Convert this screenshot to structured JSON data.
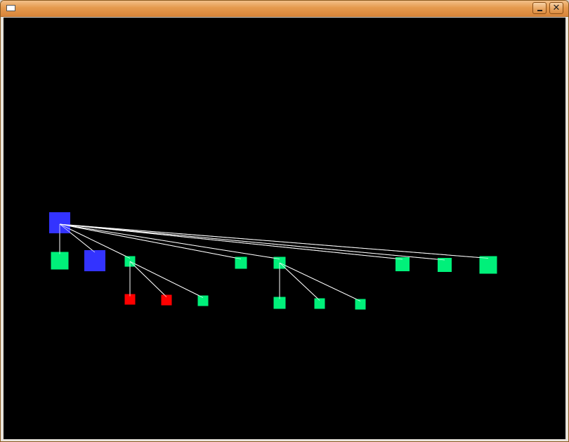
{
  "window": {
    "title": "",
    "icon": "window-icon",
    "buttons": {
      "minimize": "minimize-icon",
      "close": "close-icon"
    }
  },
  "canvas": {
    "background": "#000000",
    "edge_color": "#ffffff",
    "colors": {
      "blue": "#3333ff",
      "green": "#00f07a",
      "red": "#ff0000"
    }
  },
  "tree": {
    "nodes": [
      {
        "id": "root",
        "color": "blue"
      },
      {
        "id": "c1",
        "color": "green"
      },
      {
        "id": "c2",
        "color": "blue"
      },
      {
        "id": "c3",
        "color": "green"
      },
      {
        "id": "c4",
        "color": "green"
      },
      {
        "id": "c5",
        "color": "green"
      },
      {
        "id": "c6",
        "color": "green"
      },
      {
        "id": "c7",
        "color": "green"
      },
      {
        "id": "c8",
        "color": "green"
      },
      {
        "id": "g1",
        "color": "red"
      },
      {
        "id": "g2",
        "color": "red"
      },
      {
        "id": "g3",
        "color": "green"
      },
      {
        "id": "g4",
        "color": "green"
      },
      {
        "id": "g5",
        "color": "green"
      },
      {
        "id": "g6",
        "color": "green"
      }
    ],
    "edges": [
      [
        "root",
        "c1"
      ],
      [
        "root",
        "c2"
      ],
      [
        "root",
        "c3"
      ],
      [
        "root",
        "c4"
      ],
      [
        "root",
        "c5"
      ],
      [
        "root",
        "c6"
      ],
      [
        "root",
        "c7"
      ],
      [
        "root",
        "c8"
      ],
      [
        "c3",
        "g1"
      ],
      [
        "c3",
        "g2"
      ],
      [
        "c3",
        "g3"
      ],
      [
        "c5",
        "g4"
      ],
      [
        "c5",
        "g5"
      ],
      [
        "c5",
        "g6"
      ]
    ]
  }
}
